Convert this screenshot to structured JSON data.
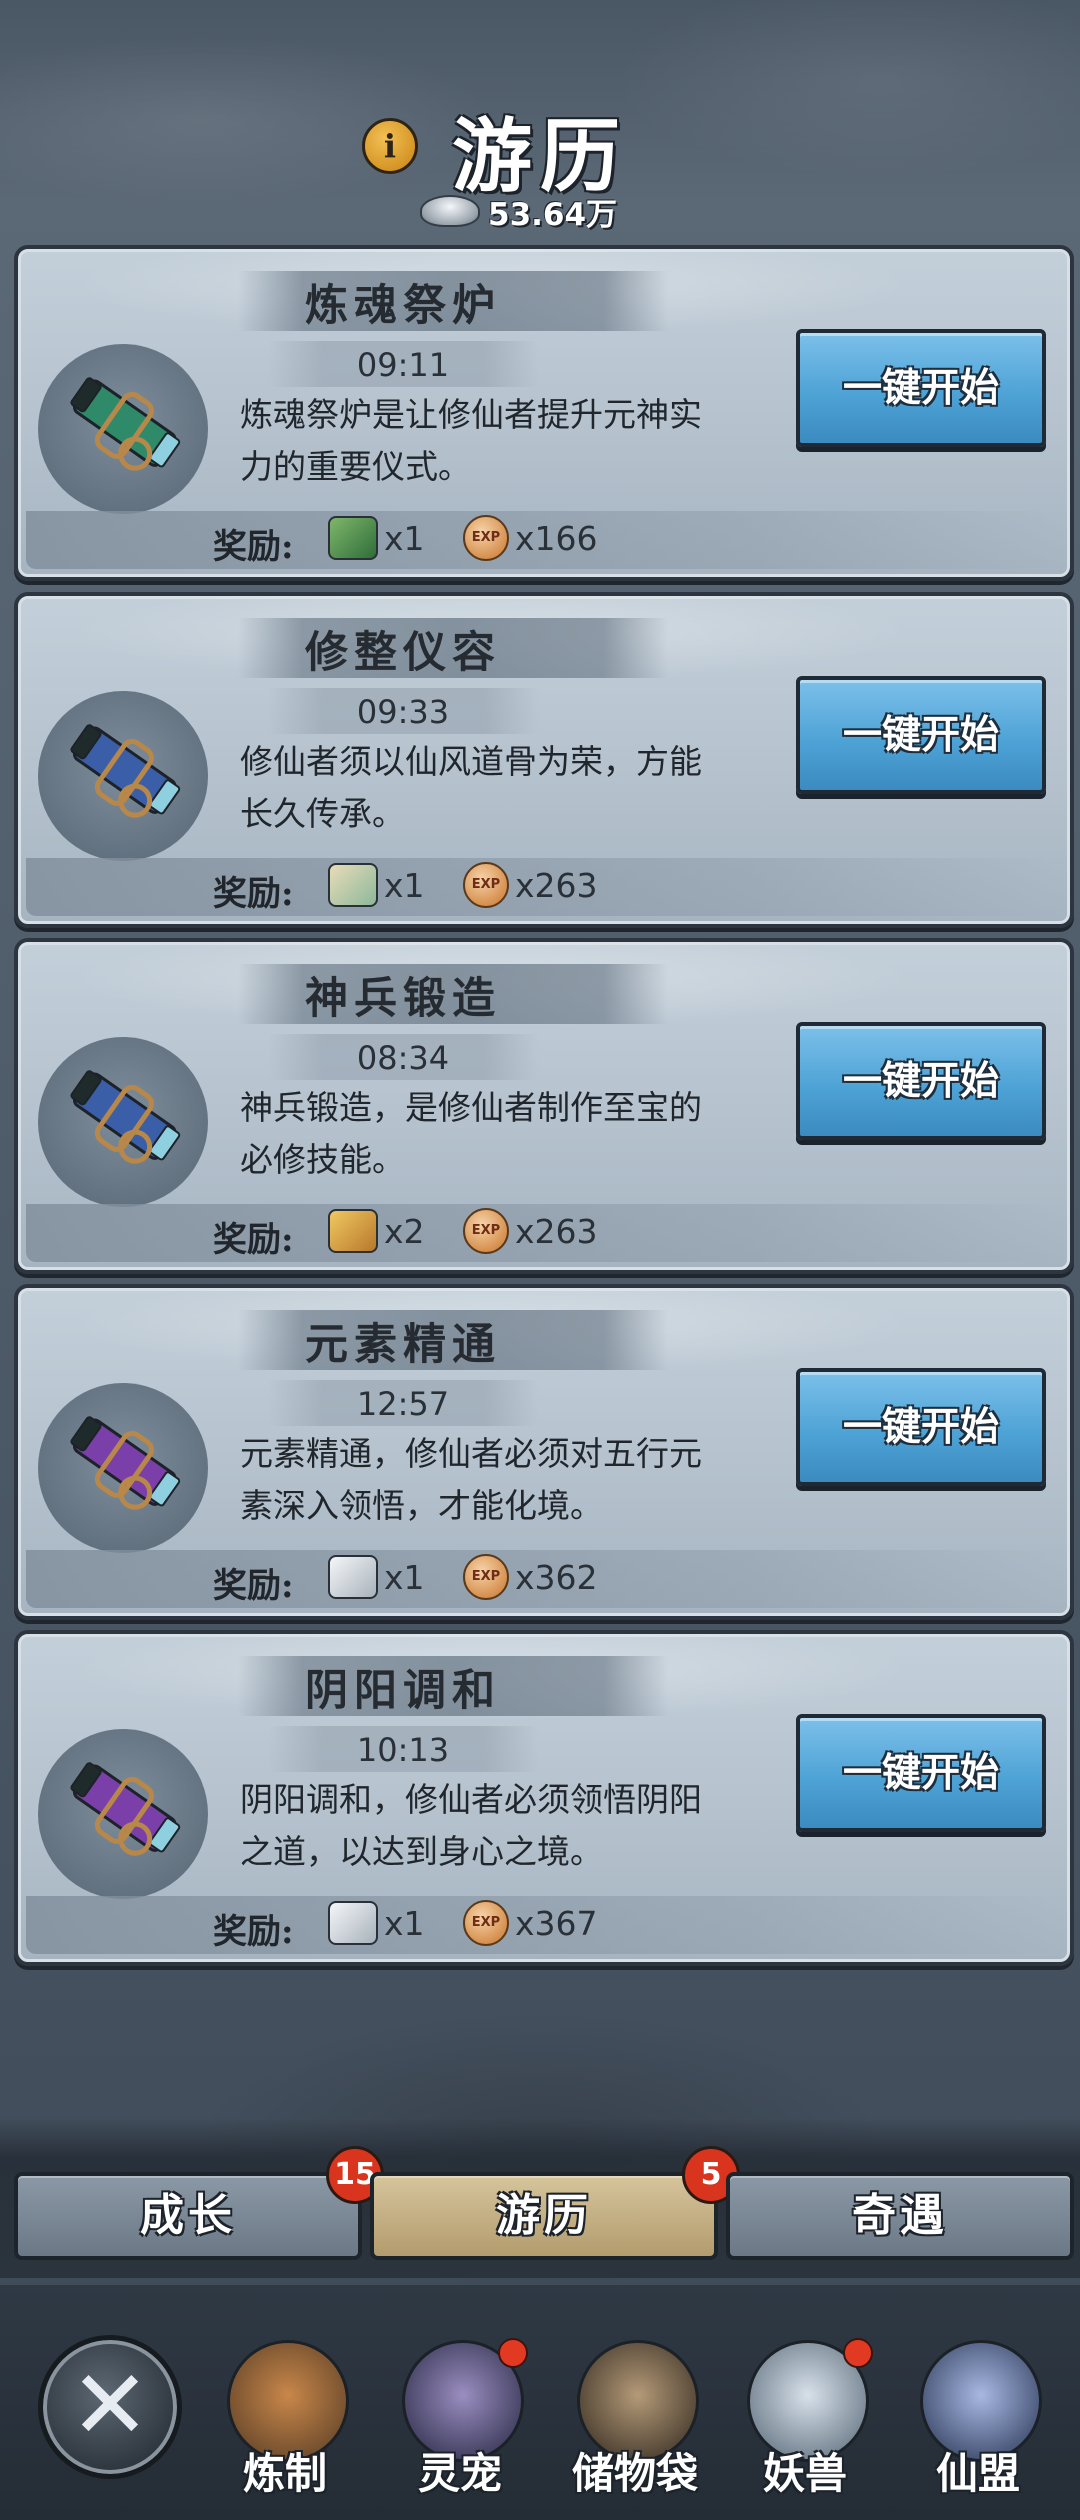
{
  "header": {
    "title": "游历",
    "info_icon": "info-icon",
    "currency_icon": "silver-ingot-icon",
    "currency_amount": "53.64万"
  },
  "quests": [
    {
      "title": "炼魂祭炉",
      "timer": "09:11",
      "description_line1": "炼魂祭炉是让修仙者提升元神实",
      "description_line2": "力的重要仪式。",
      "scroll_color": "#2f8a6a",
      "button_label": "一键开始",
      "reward_label": "奖励:",
      "reward_item_icon": "herb-icon",
      "reward_item_count": "x1",
      "exp_count": "x166"
    },
    {
      "title": "修整仪容",
      "timer": "09:33",
      "description_line1": "修仙者须以仙风道骨为荣，方能",
      "description_line2": "长久传承。",
      "scroll_color": "#3a5fa8",
      "button_label": "一键开始",
      "reward_label": "奖励:",
      "reward_item_icon": "map-scroll-icon",
      "reward_item_count": "x1",
      "exp_count": "x263"
    },
    {
      "title": "神兵锻造",
      "timer": "08:34",
      "description_line1": "神兵锻造，是修仙者制作至宝的",
      "description_line2": "必修技能。",
      "scroll_color": "#3a5fa8",
      "button_label": "一键开始",
      "reward_label": "奖励:",
      "reward_item_icon": "gold-scroll-icon",
      "reward_item_count": "x2",
      "exp_count": "x263"
    },
    {
      "title": "元素精通",
      "timer": "12:57",
      "description_line1": "元素精通，修仙者必须对五行元",
      "description_line2": "素深入领悟，才能化境。",
      "scroll_color": "#7a3fa8",
      "button_label": "一键开始",
      "reward_label": "奖励:",
      "reward_item_icon": "feather-icon",
      "reward_item_count": "x1",
      "exp_count": "x362"
    },
    {
      "title": "阴阳调和",
      "timer": "10:13",
      "description_line1": "阴阳调和，修仙者必须领悟阴阳",
      "description_line2": "之道，以达到身心之境。",
      "scroll_color": "#7a3fa8",
      "button_label": "一键开始",
      "reward_label": "奖励:",
      "reward_item_icon": "feather-icon",
      "reward_item_count": "x1",
      "exp_count": "x367"
    }
  ],
  "exp_icon_text": "EXP",
  "tabs": [
    {
      "label": "成长",
      "badge": "15"
    },
    {
      "label": "游历",
      "badge": "5"
    },
    {
      "label": "奇遇"
    }
  ],
  "bottom_nav": {
    "close_icon": "close-x-icon",
    "items": [
      {
        "label": "炼制",
        "icon": "forge-icon"
      },
      {
        "label": "灵宠",
        "icon": "spirit-pet-icon"
      },
      {
        "label": "储物袋",
        "icon": "storage-bag-icon"
      },
      {
        "label": "妖兽",
        "icon": "demon-beast-icon"
      },
      {
        "label": "仙盟",
        "icon": "immortal-alliance-icon"
      }
    ]
  }
}
